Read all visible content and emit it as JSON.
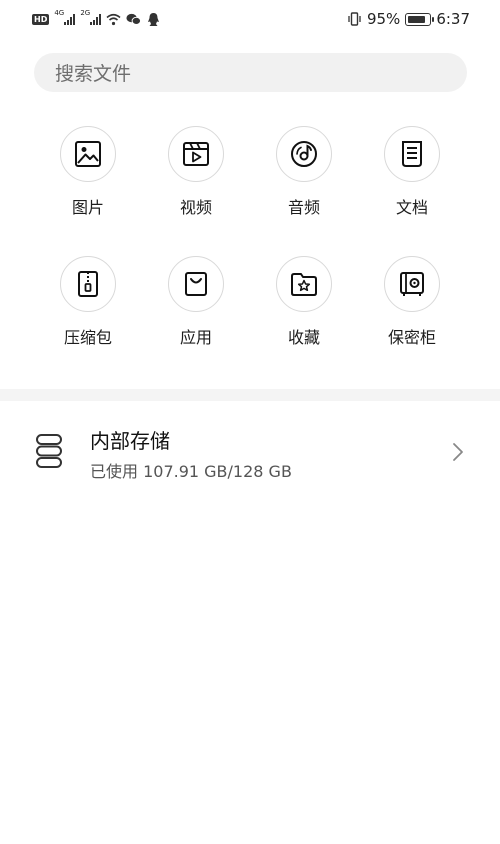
{
  "status_bar": {
    "hd": "HD",
    "sim1": "4G",
    "sim2": "2G",
    "battery_pct": "95%",
    "battery_level": 0.95,
    "time": "6:37"
  },
  "search": {
    "placeholder": "搜索文件"
  },
  "categories": [
    {
      "label": "图片",
      "icon": "image-icon"
    },
    {
      "label": "视频",
      "icon": "video-icon"
    },
    {
      "label": "音频",
      "icon": "audio-icon"
    },
    {
      "label": "文档",
      "icon": "document-icon"
    },
    {
      "label": "压缩包",
      "icon": "archive-icon"
    },
    {
      "label": "应用",
      "icon": "app-bag-icon"
    },
    {
      "label": "收藏",
      "icon": "favorite-folder-icon"
    },
    {
      "label": "保密柜",
      "icon": "safe-icon"
    }
  ],
  "storage": {
    "title": "内部存储",
    "usage": "已使用 107.91 GB/128 GB",
    "icon": "storage-icon"
  }
}
